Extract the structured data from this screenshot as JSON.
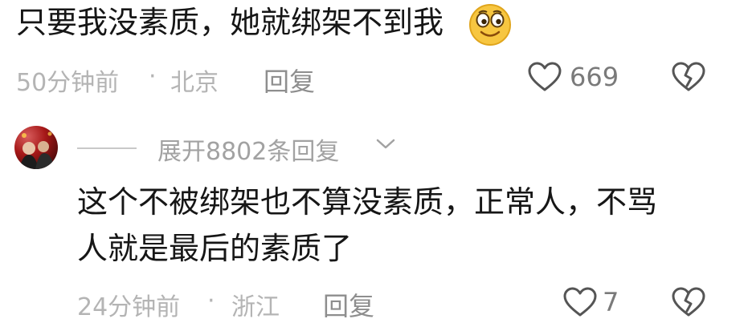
{
  "comment1": {
    "text": "只要我没素质，她就绑架不到我",
    "emoji": "smiley-emoji",
    "time": "50分钟前",
    "separator": "·",
    "location": "北京",
    "reply_label": "回复",
    "like_count": "669"
  },
  "thread": {
    "expand_label": "展开8802条回复"
  },
  "comment2": {
    "text_line1": "这个不被绑架也不算没素质，正常人，不骂",
    "text_line2": "人就是最后的素质了",
    "time": "24分钟前",
    "separator": "·",
    "location": "浙江",
    "reply_label": "回复",
    "like_count": "7"
  },
  "icons": {
    "like": "heart-outline-icon",
    "dislike": "broken-heart-icon",
    "expand": "chevron-down-icon"
  },
  "colors": {
    "text": "#161616",
    "meta": "#b4b4b4",
    "icon": "#555555",
    "emoji": "#f7c640"
  }
}
